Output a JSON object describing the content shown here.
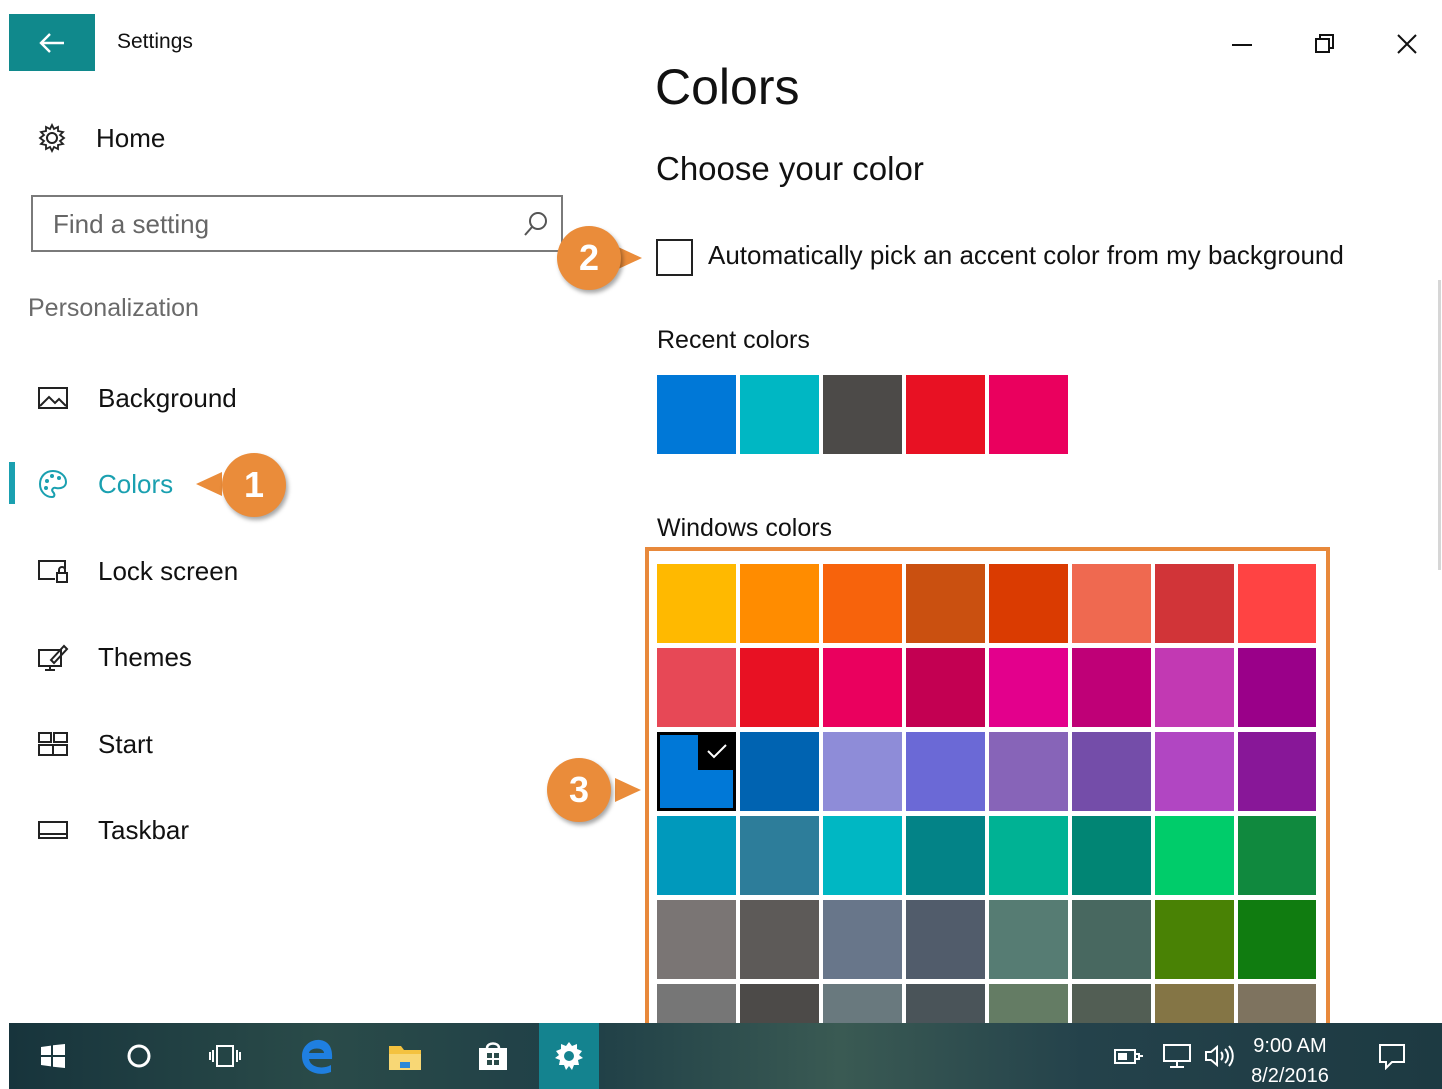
{
  "window": {
    "title": "Settings",
    "accent_color": "#10898c",
    "controls": {
      "minimize_icon": "minimize-icon",
      "restore_icon": "restore-icon",
      "close_icon": "close-icon"
    }
  },
  "sidebar": {
    "home_label": "Home",
    "search": {
      "placeholder": "Find a setting",
      "value": ""
    },
    "section_title": "Personalization",
    "items": [
      {
        "label": "Background",
        "icon": "picture-icon",
        "selected": false
      },
      {
        "label": "Colors",
        "icon": "palette-icon",
        "selected": true
      },
      {
        "label": "Lock screen",
        "icon": "lock-screen-icon",
        "selected": false
      },
      {
        "label": "Themes",
        "icon": "themes-icon",
        "selected": false
      },
      {
        "label": "Start",
        "icon": "start-icon",
        "selected": false
      },
      {
        "label": "Taskbar",
        "icon": "taskbar-icon",
        "selected": false
      }
    ],
    "selection_color": "#1aa0b0"
  },
  "content": {
    "page_title": "Colors",
    "heading": "Choose your color",
    "auto_accent": {
      "label": "Automatically pick an accent color from my background",
      "checked": false
    },
    "recent_label": "Recent colors",
    "recent_colors": [
      "#0078d7",
      "#00b7c3",
      "#4c4a48",
      "#e81123",
      "#ea005e"
    ],
    "windows_label": "Windows colors",
    "windows_colors": [
      [
        "#ffb900",
        "#ff8c00",
        "#f7630c",
        "#ca5010",
        "#da3b01",
        "#ef6950",
        "#d13438",
        "#ff4343"
      ],
      [
        "#e74856",
        "#e81123",
        "#ea005e",
        "#c30052",
        "#e3008c",
        "#bf0077",
        "#c239b3",
        "#9a0089"
      ],
      [
        "#0078d7",
        "#0063b1",
        "#8e8cd8",
        "#6b69d6",
        "#8764b8",
        "#744da9",
        "#b146c2",
        "#881798"
      ],
      [
        "#0099bc",
        "#2d7d9a",
        "#00b7c3",
        "#038387",
        "#00b294",
        "#018574",
        "#00cc6a",
        "#10893e"
      ],
      [
        "#7a7574",
        "#5d5a58",
        "#68768a",
        "#515c6b",
        "#567c73",
        "#486860",
        "#498205",
        "#107c10"
      ],
      [
        "#767676",
        "#4c4a48",
        "#69797e",
        "#4a5459",
        "#647c64",
        "#525e54",
        "#847545",
        "#7e735f"
      ]
    ],
    "selected_color": "#0078d7"
  },
  "callouts": [
    {
      "number": "1",
      "target": "Colors nav item"
    },
    {
      "number": "2",
      "target": "Auto accent checkbox"
    },
    {
      "number": "3",
      "target": "Windows colors grid"
    }
  ],
  "callout_color": "#ea8c3a",
  "taskbar": {
    "items": [
      "windows-start-icon",
      "cortana-icon",
      "task-view-icon",
      "edge-icon",
      "file-explorer-icon",
      "store-icon",
      "settings-gear-icon"
    ],
    "active_item": "settings-gear-icon",
    "tray": [
      "power-icon",
      "network-icon",
      "volume-icon"
    ],
    "clock": {
      "time": "9:00 AM",
      "date": "8/2/2016"
    },
    "notification_icon": "action-center-icon"
  }
}
